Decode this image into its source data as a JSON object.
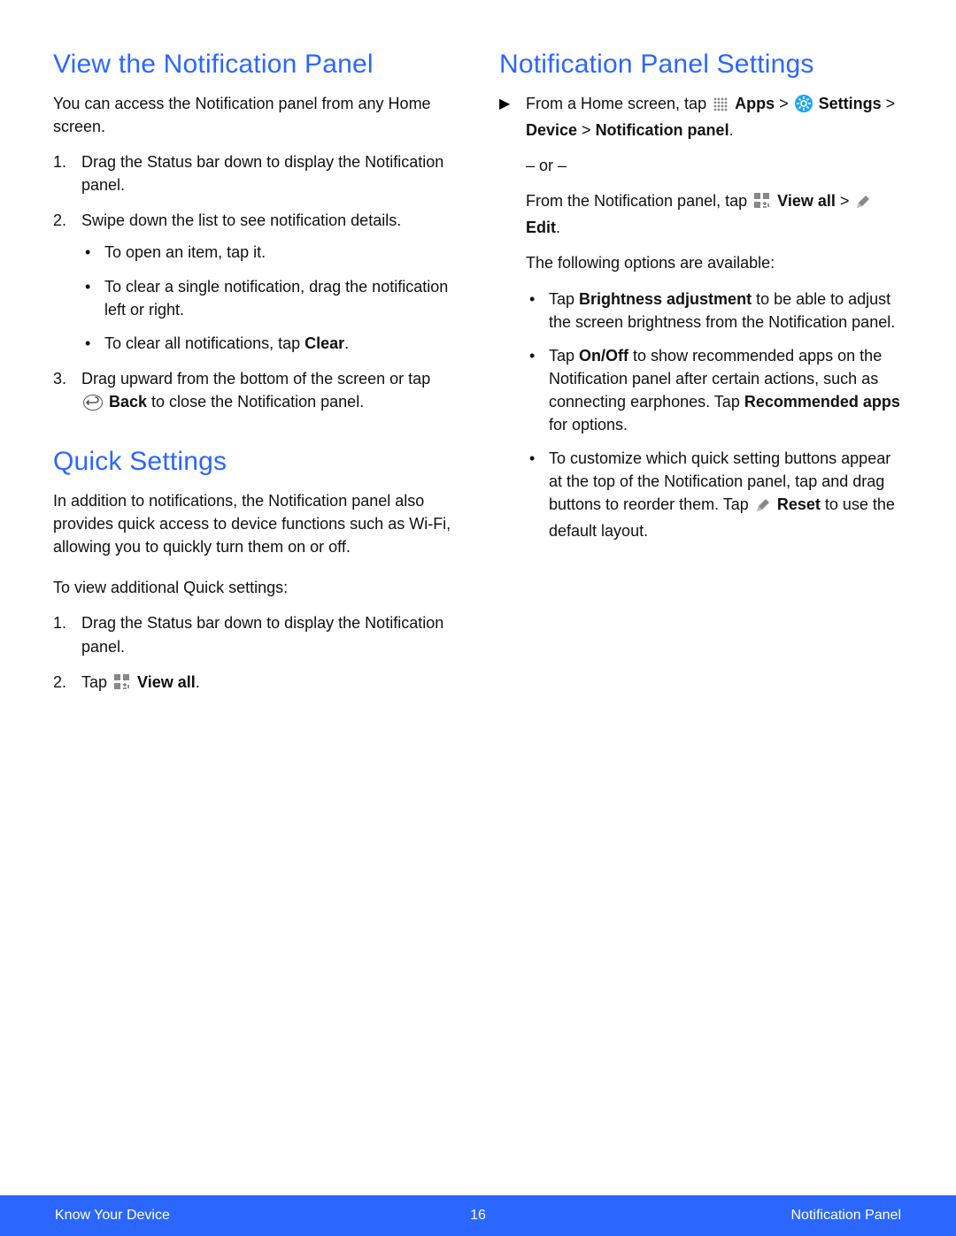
{
  "left": {
    "h_view": "View the Notification Panel",
    "p_view": "You can access the Notification panel from any Home screen.",
    "ol1": {
      "i1": "Drag the Status bar down to display the Notification panel.",
      "i2": "Swipe down the list to see notification details.",
      "i2_b1": "To open an item, tap it.",
      "i2_b2": "To clear a single notification, drag the notification left or right.",
      "i2_b3_a": "To clear all notifications, tap ",
      "i2_b3_b": "Clear",
      "i2_b3_c": ".",
      "i3_a": "Drag upward from the bottom of the screen or tap ",
      "i3_b": "Back",
      "i3_c": " to close the Notification panel."
    },
    "h_qs": "Quick Settings",
    "p_qs": "In addition to notifications, the Notification panel also provides quick access to device functions such as Wi-Fi, allowing you to quickly turn them on or off.",
    "p_qs2": "To view additional Quick settings:",
    "ol2": {
      "i1": "Drag the Status bar down to display the Notification panel.",
      "i2_a": "Tap ",
      "i2_b": "View all",
      "i2_c": "."
    }
  },
  "right": {
    "h_nps": "Notification Panel Settings",
    "step1_a": "From a Home screen, tap ",
    "step1_apps": "Apps",
    "gt": " > ",
    "step1_settings": "Settings",
    "step1_b": " > ",
    "step1_device": "Device",
    "step1_c": " > ",
    "step1_np": "Notification panel",
    "step1_d": ".",
    "or": "– or –",
    "alt_a": "From the Notification panel, tap ",
    "alt_va": "View all",
    "alt_b": " > ",
    "alt_edit": "Edit",
    "alt_c": ".",
    "p_opts": "The following options are available:",
    "b1_a": "Tap ",
    "b1_b": "Brightness adjustment",
    "b1_c": " to be able to adjust the screen brightness from the Notification panel.",
    "b2_a": "Tap ",
    "b2_b": "On/Off",
    "b2_c": " to show recommended apps on the Notification panel after certain actions, such as connecting earphones. Tap ",
    "b2_d": "Recommended apps",
    "b2_e": " for options.",
    "b3_a": "To customize which quick setting buttons appear at the top of the Notification panel, tap and drag buttons to reorder them. Tap ",
    "b3_b": "Reset",
    "b3_c": " to use the default layout."
  },
  "footer": {
    "left": "Know Your Device",
    "center": "16",
    "right": "Notification Panel"
  }
}
